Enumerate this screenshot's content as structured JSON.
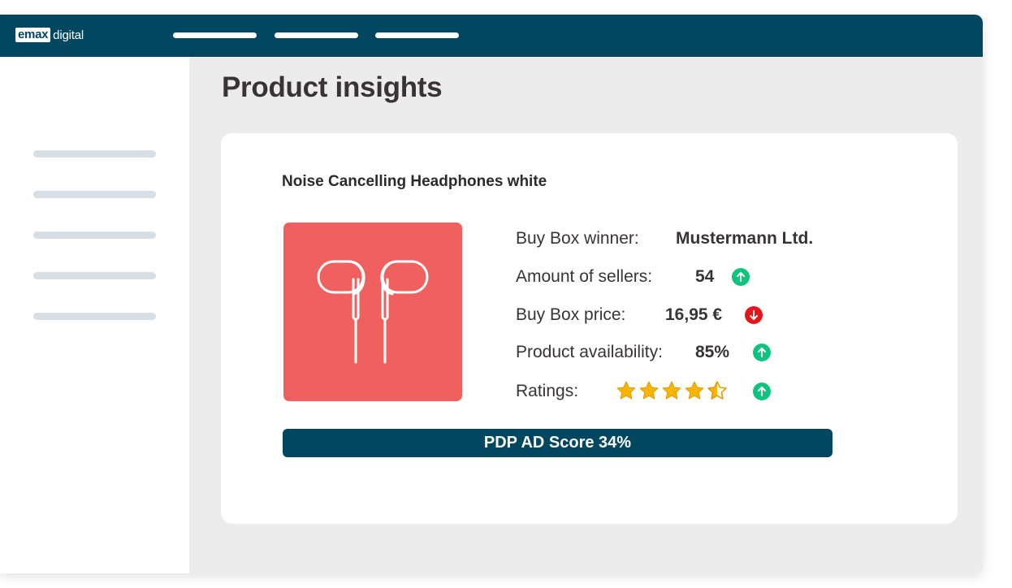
{
  "header": {
    "logo_box": "emax",
    "logo_text": "digital",
    "nav_items": 3
  },
  "page": {
    "title": "Product insights"
  },
  "sidebar": {
    "item_count": 5
  },
  "product": {
    "name": "Noise Cancelling Headphones white",
    "image_icon": "earphones-icon",
    "image_bg": "#f0605e",
    "metrics": {
      "buy_box_winner": {
        "label": "Buy Box winner:",
        "value": "Mustermann Ltd."
      },
      "sellers": {
        "label": "Amount of sellers:",
        "value": "54",
        "trend": "up"
      },
      "price": {
        "label": "Buy Box price:",
        "value": "16,95 €",
        "trend": "down"
      },
      "availability": {
        "label": "Product availability:",
        "value": "85%",
        "trend": "up"
      },
      "ratings": {
        "label": "Ratings:",
        "stars": 4.5,
        "max": 5,
        "trend": "up"
      }
    },
    "score_label": "PDP AD Score 34%"
  },
  "colors": {
    "brand": "#02465f",
    "trend_up": "#0fc47c",
    "trend_down": "#e8141c",
    "star": "#f7b500"
  }
}
